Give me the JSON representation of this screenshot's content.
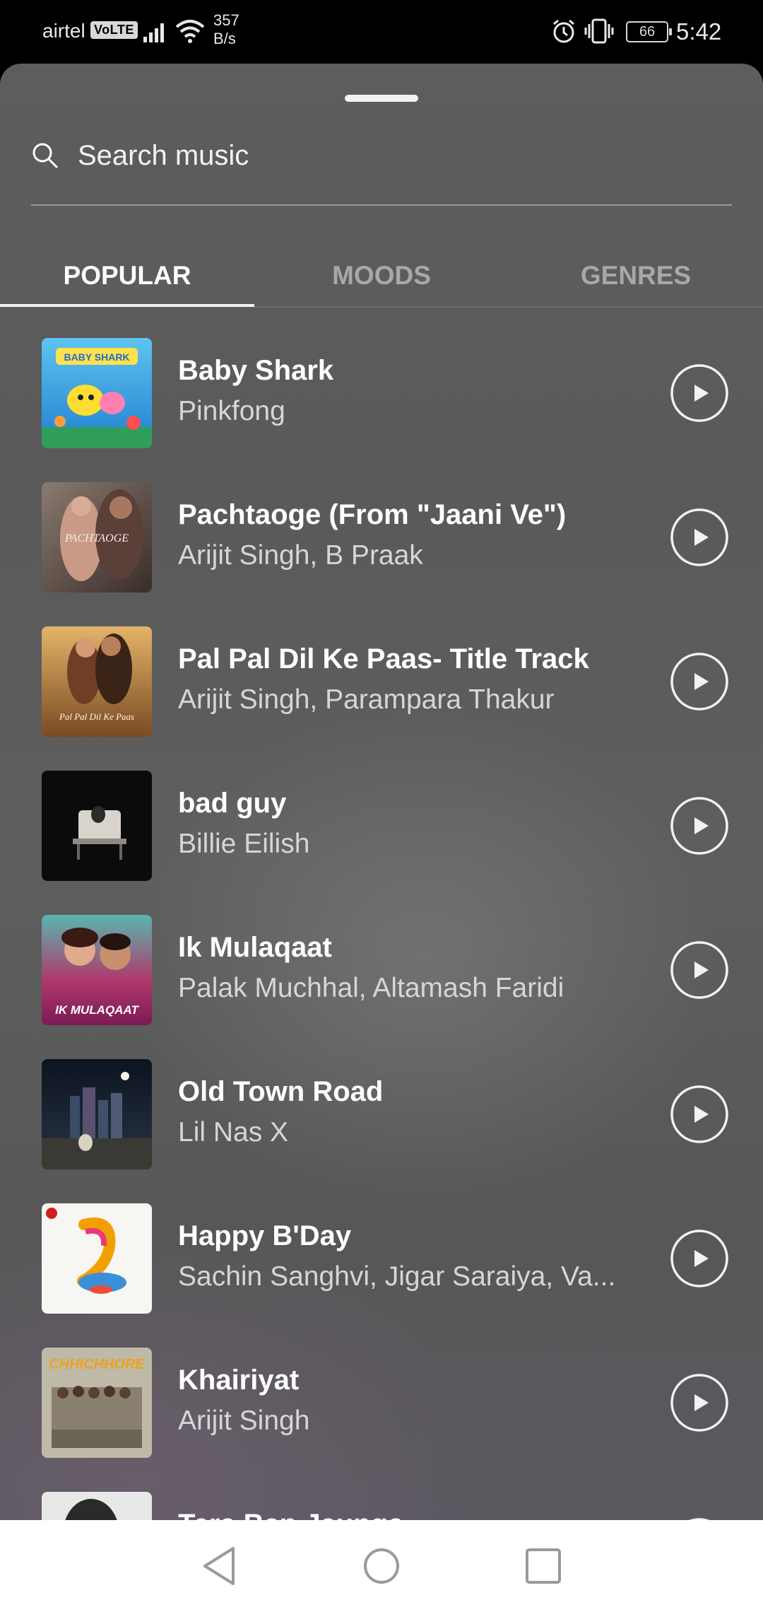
{
  "status_bar": {
    "carrier": "airtel",
    "volte": "VoLTE",
    "net_speed_value": "357",
    "net_speed_unit": "B/s",
    "battery": "66",
    "time": "5:42"
  },
  "search": {
    "placeholder": "Search music"
  },
  "tabs": [
    {
      "label": "POPULAR",
      "active": true
    },
    {
      "label": "MOODS",
      "active": false
    },
    {
      "label": "GENRES",
      "active": false
    }
  ],
  "tracks": [
    {
      "title": "Baby Shark",
      "artist": "Pinkfong"
    },
    {
      "title": "Pachtaoge (From \"Jaani Ve\")",
      "artist": "Arijit Singh, B Praak"
    },
    {
      "title": "Pal Pal Dil Ke Paas- Title Track",
      "artist": "Arijit Singh, Parampara Thakur"
    },
    {
      "title": "bad guy",
      "artist": "Billie Eilish"
    },
    {
      "title": "Ik Mulaqaat",
      "artist": "Palak Muchhal, Altamash Faridi"
    },
    {
      "title": "Old Town Road",
      "artist": "Lil Nas X"
    },
    {
      "title": "Happy B'Day",
      "artist": "Sachin Sanghvi, Jigar Saraiya, Va..."
    },
    {
      "title": "Khairiyat",
      "artist": "Arijit Singh"
    },
    {
      "title": "Tera Ban Jaunga",
      "artist": ""
    }
  ],
  "covers": {
    "baby_shark_text": "BABY SHARK",
    "pachtaoge_text": "PACHTAOGE",
    "pal_pal_text": "Pal Pal Dil Ke Paas",
    "ik_mulaqaat_text": "IK MULAQAAT",
    "khairiyat_text": "CHHICHHORE"
  },
  "colors": {
    "accent": "#ffffff",
    "inactive_tab": "#a8a8a8",
    "sheet_bg": "#5b5b5b",
    "nav_bg": "#ffffff"
  },
  "icons": {
    "search": "search-icon",
    "play": "play-icon",
    "back": "back-icon",
    "home": "home-icon",
    "recents": "recents-icon"
  }
}
